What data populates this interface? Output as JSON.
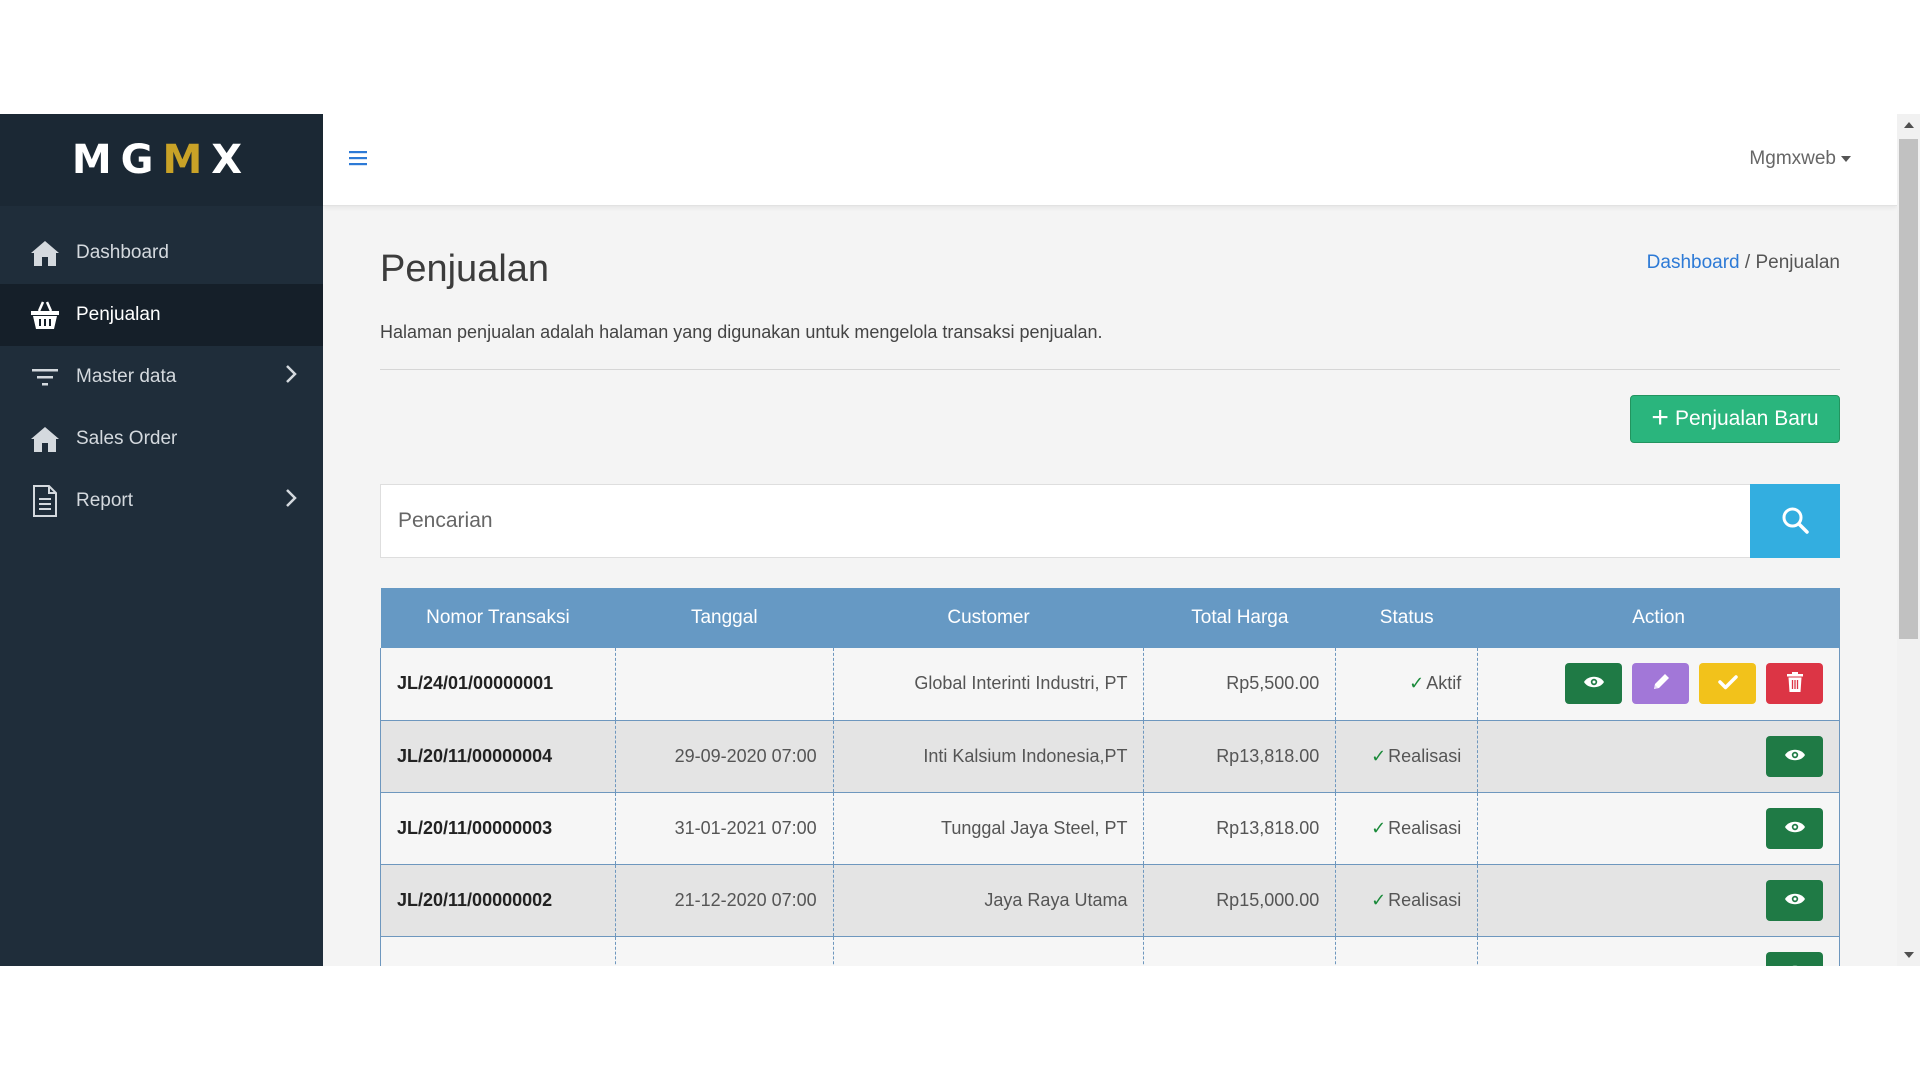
{
  "brand": {
    "letters_left": "MG",
    "letter_accent": "M",
    "letters_right": "X"
  },
  "sidebar": {
    "items": [
      {
        "label": "Dashboard",
        "icon": "home-icon"
      },
      {
        "label": "Penjualan",
        "icon": "basket-icon",
        "active": true
      },
      {
        "label": "Master data",
        "icon": "filter-icon",
        "has_submenu": true
      },
      {
        "label": "Sales Order",
        "icon": "home-icon"
      },
      {
        "label": "Report",
        "icon": "document-icon",
        "has_submenu": true
      }
    ]
  },
  "topbar": {
    "user_name": "Mgmxweb"
  },
  "page": {
    "title": "Penjualan",
    "breadcrumb": {
      "home": "Dashboard",
      "separator": " / ",
      "current": "Penjualan"
    },
    "description": "Halaman penjualan adalah halaman yang digunakan untuk mengelola transaksi penjualan.",
    "new_button_label": "Penjualan Baru",
    "new_button_plus": "+"
  },
  "search": {
    "placeholder": "Pencarian"
  },
  "table": {
    "headers": [
      "Nomor Transaksi",
      "Tanggal",
      "Customer",
      "Total Harga",
      "Status",
      "Action"
    ],
    "rows": [
      {
        "nomor": "JL/24/01/00000001",
        "tanggal": "",
        "customer": "Global Interinti Industri, PT",
        "total": "Rp5,500.00",
        "status": "Aktif",
        "check": "✓"
      },
      {
        "nomor": "JL/20/11/00000004",
        "tanggal": "29-09-2020 07:00",
        "customer": "Inti Kalsium Indonesia,PT",
        "total": "Rp13,818.00",
        "status": "Realisasi",
        "check": "✓"
      },
      {
        "nomor": "JL/20/11/00000003",
        "tanggal": "31-01-2021 07:00",
        "customer": "Tunggal Jaya Steel, PT",
        "total": "Rp13,818.00",
        "status": "Realisasi",
        "check": "✓"
      },
      {
        "nomor": "JL/20/11/00000002",
        "tanggal": "21-12-2020 07:00",
        "customer": "Jaya Raya Utama",
        "total": "Rp15,000.00",
        "status": "Realisasi",
        "check": "✓"
      }
    ]
  },
  "colors": {
    "sidebar_bg": "#1f2d3a",
    "table_header": "#6699c4",
    "primary_green": "#2ab57d",
    "search_button": "#33aee0",
    "view_button": "#1f7a45",
    "edit_button": "#a277d8",
    "approve_button": "#f2c21b",
    "delete_button": "#dc3545"
  }
}
